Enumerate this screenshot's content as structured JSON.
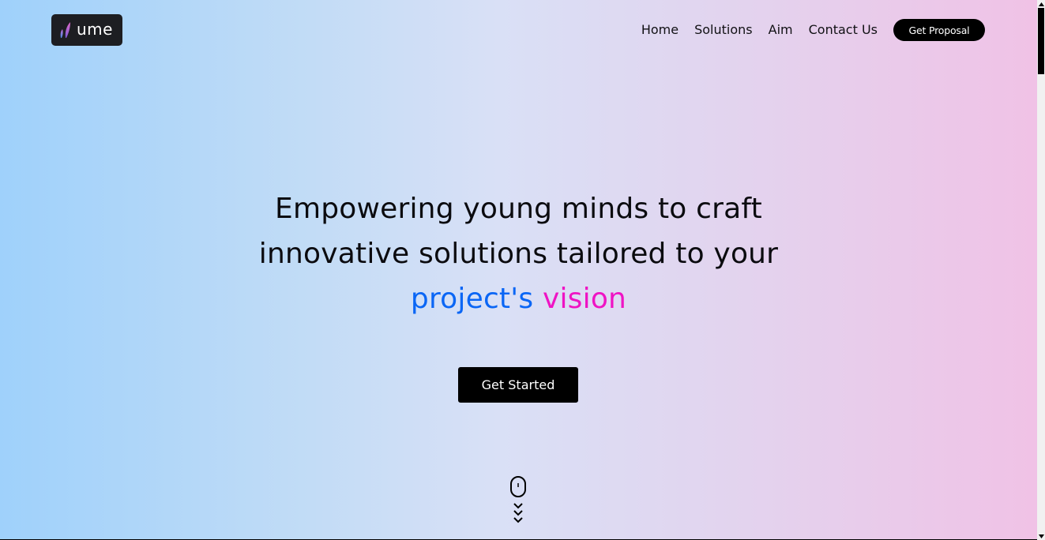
{
  "header": {
    "logo_text": "ume",
    "logo_icon": "ume-logo-mark",
    "nav": [
      {
        "label": "Home"
      },
      {
        "label": "Solutions"
      },
      {
        "label": "Aim"
      },
      {
        "label": "Contact Us"
      }
    ],
    "proposal_label": "Get Proposal"
  },
  "hero": {
    "line1": "Empowering young minds to craft",
    "line2": "innovative solutions tailored to your",
    "highlight_blue": "project's",
    "highlight_pink": "vision",
    "cta_label": "Get Started",
    "scroll_icon": "mouse-scroll-icon"
  },
  "colors": {
    "blue_highlight": "#0a66f5",
    "pink_highlight": "#ef14c4",
    "button_bg": "#000000",
    "gradient_start": "#9fd1fb",
    "gradient_end": "#f0c2e6"
  }
}
